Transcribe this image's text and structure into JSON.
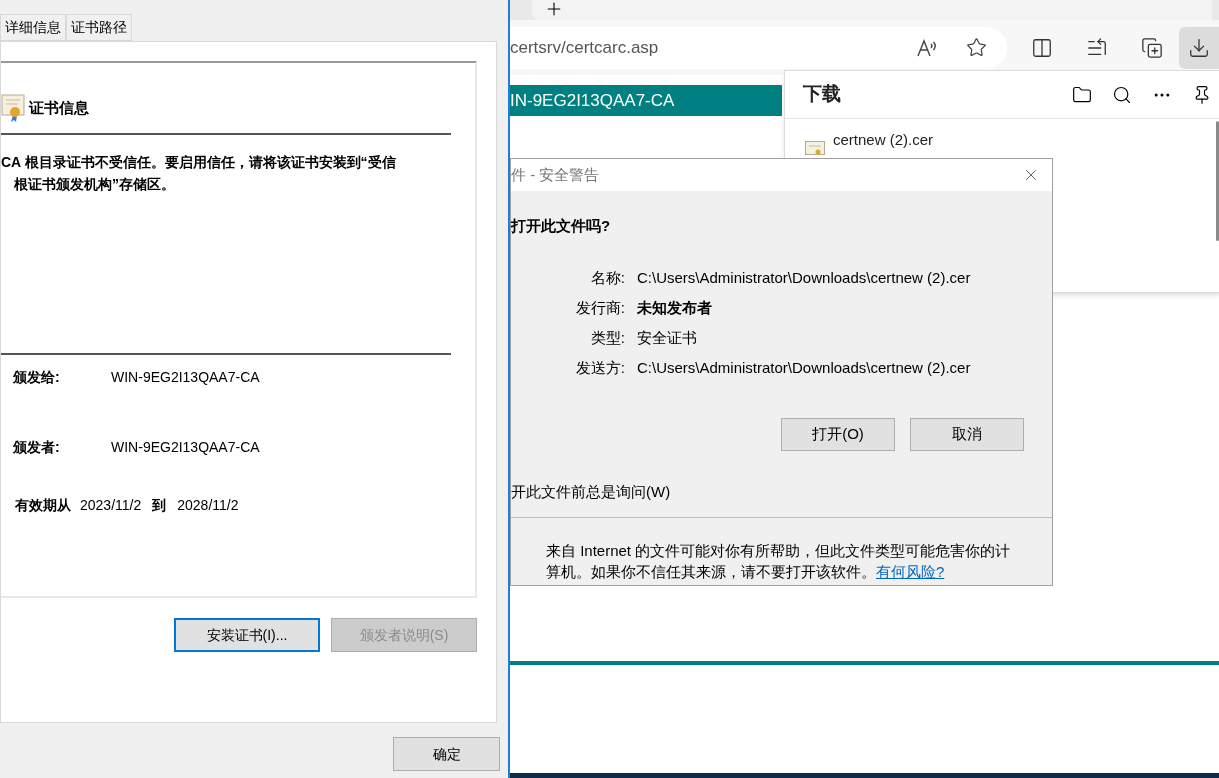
{
  "certificate_dialog": {
    "tabs": [
      {
        "label": "详细信息",
        "selected": false
      },
      {
        "label": "证书路径",
        "selected": false
      }
    ],
    "heading": "证书信息",
    "warning_lines": [
      "CA 根目录证书不受信任。要启用信任，请将该证书安装到“受信",
      "根证书颁发机构”存储区。"
    ],
    "fields": [
      {
        "label": "颁发给:",
        "value": "WIN-9EG2I13QAA7-CA"
      },
      {
        "label": "颁发者:",
        "value": "WIN-9EG2I13QAA7-CA"
      }
    ],
    "validity": {
      "label": "有效期从",
      "from": "2023/11/2",
      "to_label": "到",
      "to": "2028/11/2"
    },
    "buttons": [
      {
        "label": "安装证书(I)...",
        "focused": true,
        "disabled": false
      },
      {
        "label": "颁发者说明(S)",
        "focused": false,
        "disabled": true
      }
    ],
    "ok_button": "确定"
  },
  "browser": {
    "address": "certsrv/certcarc.asp",
    "page_heading": "IN-9EG2I13QAA7-CA",
    "downloads": {
      "title": "下载",
      "items": [
        {
          "name": "certnew (2).cer"
        }
      ]
    }
  },
  "security_dialog": {
    "title": "件 - 安全警告",
    "question": "打开此文件吗?",
    "fields": [
      {
        "label": "名称:",
        "value": "C:\\Users\\Administrator\\Downloads\\certnew (2).cer",
        "bold": false
      },
      {
        "label": "发行商:",
        "value": "未知发布者",
        "bold": true
      },
      {
        "label": "类型:",
        "value": "安全证书",
        "bold": false
      },
      {
        "label": "发送方:",
        "value": "C:\\Users\\Administrator\\Downloads\\certnew (2).cer",
        "bold": false
      }
    ],
    "buttons": [
      "打开(O)",
      "取消"
    ],
    "checkbox_label": "开此文件前总是询问(W)",
    "notice": "来自 Internet 的文件可能对你有所帮助，但此文件类型可能危害你的计算机。如果你不信任其来源，请不要打开该软件。",
    "link": "有何风险?"
  }
}
